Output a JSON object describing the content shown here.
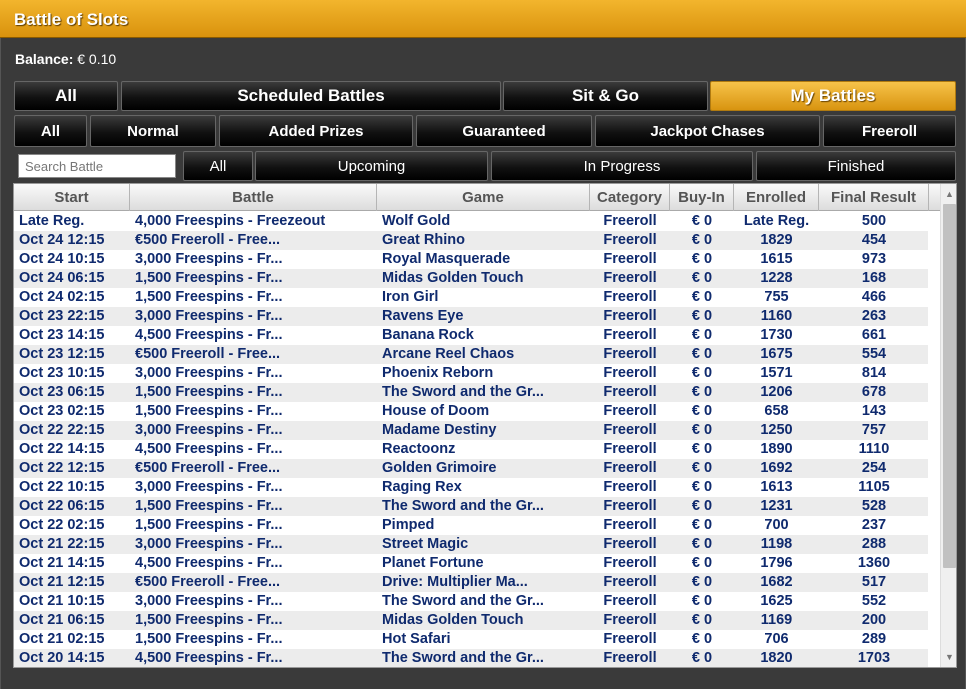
{
  "app": {
    "title": "Battle of Slots"
  },
  "balance": {
    "label": "Balance:",
    "value": "€ 0.10"
  },
  "main_tabs": [
    "All",
    "Scheduled Battles",
    "Sit & Go",
    "My Battles"
  ],
  "category_tabs": [
    "All",
    "Normal",
    "Added Prizes",
    "Guaranteed",
    "Jackpot Chases",
    "Freeroll"
  ],
  "search": {
    "placeholder": "Search Battle"
  },
  "status_tabs": [
    "All",
    "Upcoming",
    "In Progress",
    "Finished"
  ],
  "table": {
    "headers": [
      "Start",
      "Battle",
      "Game",
      "Category",
      "Buy-In",
      "Enrolled",
      "Final Result"
    ],
    "rows": [
      [
        "Late Reg.",
        "4,000 Freespins - Freezeout",
        "Wolf Gold",
        "Freeroll",
        "€ 0",
        "Late Reg.",
        "500"
      ],
      [
        "Oct 24 12:15",
        "€500 Freeroll - Free...",
        "Great Rhino",
        "Freeroll",
        "€ 0",
        "1829",
        "454"
      ],
      [
        "Oct 24 10:15",
        "3,000 Freespins - Fr...",
        "Royal Masquerade",
        "Freeroll",
        "€ 0",
        "1615",
        "973"
      ],
      [
        "Oct 24 06:15",
        "1,500 Freespins - Fr...",
        "Midas Golden Touch",
        "Freeroll",
        "€ 0",
        "1228",
        "168"
      ],
      [
        "Oct 24 02:15",
        "1,500 Freespins - Fr...",
        "Iron Girl",
        "Freeroll",
        "€ 0",
        "755",
        "466"
      ],
      [
        "Oct 23 22:15",
        "3,000 Freespins - Fr...",
        "Ravens Eye",
        "Freeroll",
        "€ 0",
        "1160",
        "263"
      ],
      [
        "Oct 23 14:15",
        "4,500 Freespins - Fr...",
        "Banana Rock",
        "Freeroll",
        "€ 0",
        "1730",
        "661"
      ],
      [
        "Oct 23 12:15",
        "€500 Freeroll - Free...",
        "Arcane Reel Chaos",
        "Freeroll",
        "€ 0",
        "1675",
        "554"
      ],
      [
        "Oct 23 10:15",
        "3,000 Freespins - Fr...",
        "Phoenix Reborn",
        "Freeroll",
        "€ 0",
        "1571",
        "814"
      ],
      [
        "Oct 23 06:15",
        "1,500 Freespins - Fr...",
        "The Sword and the Gr...",
        "Freeroll",
        "€ 0",
        "1206",
        "678"
      ],
      [
        "Oct 23 02:15",
        "1,500 Freespins - Fr...",
        "House of Doom",
        "Freeroll",
        "€ 0",
        "658",
        "143"
      ],
      [
        "Oct 22 22:15",
        "3,000 Freespins - Fr...",
        "Madame Destiny",
        "Freeroll",
        "€ 0",
        "1250",
        "757"
      ],
      [
        "Oct 22 14:15",
        "4,500 Freespins - Fr...",
        "Reactoonz",
        "Freeroll",
        "€ 0",
        "1890",
        "1110"
      ],
      [
        "Oct 22 12:15",
        "€500 Freeroll - Free...",
        "Golden Grimoire",
        "Freeroll",
        "€ 0",
        "1692",
        "254"
      ],
      [
        "Oct 22 10:15",
        "3,000 Freespins - Fr...",
        "Raging Rex",
        "Freeroll",
        "€ 0",
        "1613",
        "1105"
      ],
      [
        "Oct 22 06:15",
        "1,500 Freespins - Fr...",
        "The Sword and the Gr...",
        "Freeroll",
        "€ 0",
        "1231",
        "528"
      ],
      [
        "Oct 22 02:15",
        "1,500 Freespins - Fr...",
        "Pimped",
        "Freeroll",
        "€ 0",
        "700",
        "237"
      ],
      [
        "Oct 21 22:15",
        "3,000 Freespins - Fr...",
        "Street Magic",
        "Freeroll",
        "€ 0",
        "1198",
        "288"
      ],
      [
        "Oct 21 14:15",
        "4,500 Freespins - Fr...",
        "Planet Fortune",
        "Freeroll",
        "€ 0",
        "1796",
        "1360"
      ],
      [
        "Oct 21 12:15",
        "€500 Freeroll - Free...",
        "Drive: Multiplier Ma...",
        "Freeroll",
        "€ 0",
        "1682",
        "517"
      ],
      [
        "Oct 21 10:15",
        "3,000 Freespins - Fr...",
        "The Sword and the Gr...",
        "Freeroll",
        "€ 0",
        "1625",
        "552"
      ],
      [
        "Oct 21 06:15",
        "1,500 Freespins - Fr...",
        "Midas Golden Touch",
        "Freeroll",
        "€ 0",
        "1169",
        "200"
      ],
      [
        "Oct 21 02:15",
        "1,500 Freespins - Fr...",
        "Hot Safari",
        "Freeroll",
        "€ 0",
        "706",
        "289"
      ],
      [
        "Oct 20 14:15",
        "4,500 Freespins - Fr...",
        "The Sword and the Gr...",
        "Freeroll",
        "€ 0",
        "1820",
        "1703"
      ]
    ]
  },
  "scrollbar": {
    "up_icon": "▲",
    "down_icon": "▼"
  },
  "colors": {
    "accent": "#f2b52d",
    "row_text": "#0f2a6e"
  }
}
